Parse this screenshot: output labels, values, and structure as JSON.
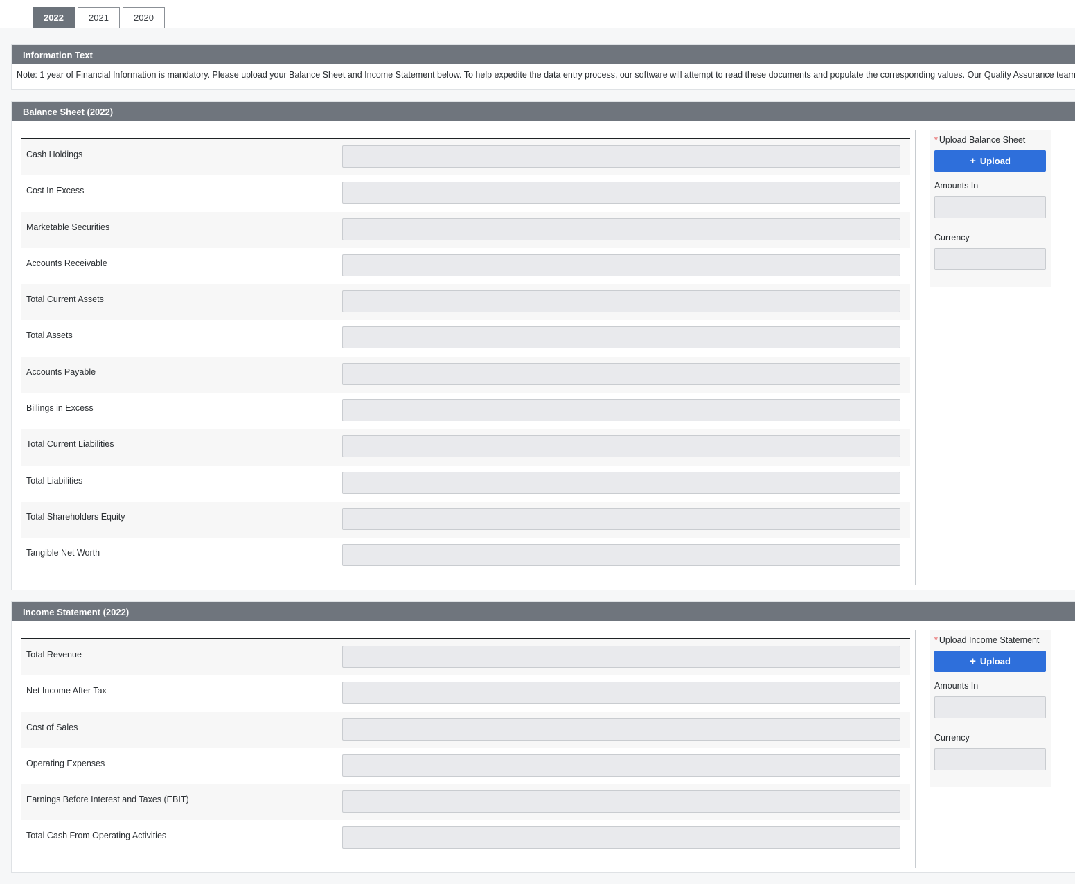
{
  "tabs": [
    {
      "label": "2022",
      "active": true
    },
    {
      "label": "2021",
      "active": false
    },
    {
      "label": "2020",
      "active": false
    }
  ],
  "info": {
    "title": "Information Text",
    "text": "Note: 1 year of Financial Information is mandatory. Please upload your Balance Sheet and Income Statement below. To help expedite the data entry process, our software will attempt to read these documents and populate the corresponding values. Our Quality Assurance team"
  },
  "balance_sheet": {
    "title": "Balance Sheet (2022)",
    "fields": [
      {
        "label": "Cash Holdings",
        "value": ""
      },
      {
        "label": "Cost In Excess",
        "value": ""
      },
      {
        "label": "Marketable Securities",
        "value": ""
      },
      {
        "label": "Accounts Receivable",
        "value": ""
      },
      {
        "label": "Total Current Assets",
        "value": ""
      },
      {
        "label": "Total Assets",
        "value": ""
      },
      {
        "label": "Accounts Payable",
        "value": ""
      },
      {
        "label": "Billings in Excess",
        "value": ""
      },
      {
        "label": "Total Current Liabilities",
        "value": ""
      },
      {
        "label": "Total Liabilities",
        "value": ""
      },
      {
        "label": "Total Shareholders Equity",
        "value": ""
      },
      {
        "label": "Tangible Net Worth",
        "value": ""
      }
    ],
    "upload": {
      "required_mark": "*",
      "label": "Upload Balance Sheet",
      "button_icon": "+",
      "button_label": "Upload",
      "amounts_label": "Amounts In",
      "amounts_value": "",
      "currency_label": "Currency",
      "currency_value": ""
    }
  },
  "income_statement": {
    "title": "Income Statement (2022)",
    "fields": [
      {
        "label": "Total Revenue",
        "value": ""
      },
      {
        "label": "Net Income After Tax",
        "value": ""
      },
      {
        "label": "Cost of Sales",
        "value": ""
      },
      {
        "label": "Operating Expenses",
        "value": ""
      },
      {
        "label": "Earnings Before Interest and Taxes (EBIT)",
        "value": ""
      },
      {
        "label": "Total Cash From Operating Activities",
        "value": ""
      }
    ],
    "upload": {
      "required_mark": "*",
      "label": "Upload Income Statement",
      "button_icon": "+",
      "button_label": "Upload",
      "amounts_label": "Amounts In",
      "amounts_value": "",
      "currency_label": "Currency",
      "currency_value": ""
    }
  },
  "colors": {
    "header_bg": "#6f757d",
    "accent": "#2e6fdb",
    "required": "#e02424"
  }
}
